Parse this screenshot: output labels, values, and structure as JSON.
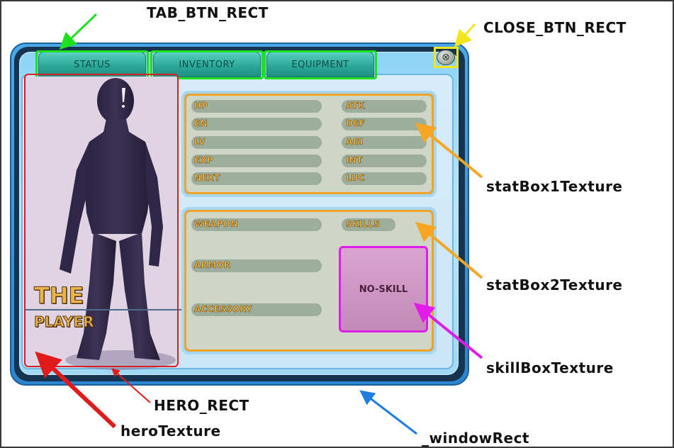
{
  "window": {
    "tabs": [
      {
        "label": "STATUS"
      },
      {
        "label": "INVENTORY"
      },
      {
        "label": "EQUIPMENT"
      }
    ],
    "close_glyph": "⊗"
  },
  "hero": {
    "title_line1": "THE",
    "title_line2": "PLAYER"
  },
  "stat_box1": {
    "left": [
      "HP",
      "EN",
      "LV",
      "EXP",
      "NEXT"
    ],
    "right": [
      "ATK",
      "DEF",
      "AGI",
      "INT",
      "LUC"
    ]
  },
  "stat_box2": {
    "weapon": "WEAPON",
    "skills": "SKILLS",
    "armor": "ARMOR",
    "accessory": "ACCESSORY",
    "skill_text": "NO-SKILL"
  },
  "callouts": {
    "tab_btn_rect": "TAB_BTN_RECT",
    "close_btn_rect": "CLOSE_BTN_RECT",
    "stat_box1": "statBox1Texture",
    "stat_box2": "statBox2Texture",
    "skill_box": "skillBoxTexture",
    "hero_rect": "HERO_RECT",
    "hero_texture": "heroTexture",
    "window_rect": "_windowRect"
  },
  "colors": {
    "tab_highlight": "#1ee01e",
    "close_highlight": "#f4e51c",
    "hero_highlight": "#e11b1b",
    "stat_arrow": "#f5a623",
    "skill_highlight": "#e11be8",
    "window_arrow": "#1f7fe0",
    "stat_text": "#f2c04a"
  }
}
